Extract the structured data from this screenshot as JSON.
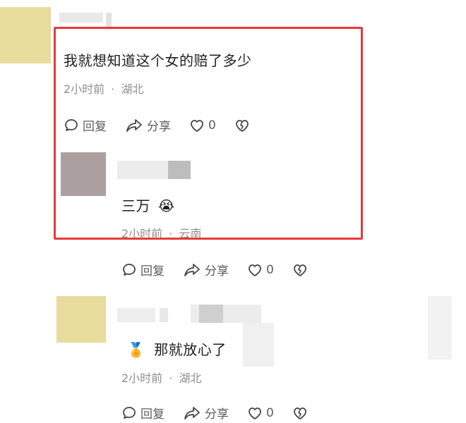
{
  "comments": [
    {
      "text": "我就想知道这个女的赔了多少",
      "time": "2小时前",
      "location": "湖北",
      "reply_label": "回复",
      "share_label": "分享",
      "like_count": "0"
    },
    {
      "text": "三万",
      "emoji": "😭",
      "time": "2小时前",
      "location": "云南",
      "reply_label": "回复",
      "share_label": "分享",
      "like_count": "0"
    },
    {
      "text": "那就放心了",
      "emoji": "🏅",
      "time": "2小时前",
      "location": "湖北",
      "reply_label": "回复",
      "share_label": "分享",
      "like_count": "0"
    }
  ],
  "meta_separator": "·",
  "colors": {
    "highlight_border": "#e83a3a",
    "avatar_yellow": "#e8dc9c",
    "avatar_mauve": "#ab9fa0",
    "meta_gray": "#8f8f8f"
  },
  "icons": [
    "reply-icon",
    "share-icon",
    "heart-icon",
    "broken-heart-icon"
  ]
}
